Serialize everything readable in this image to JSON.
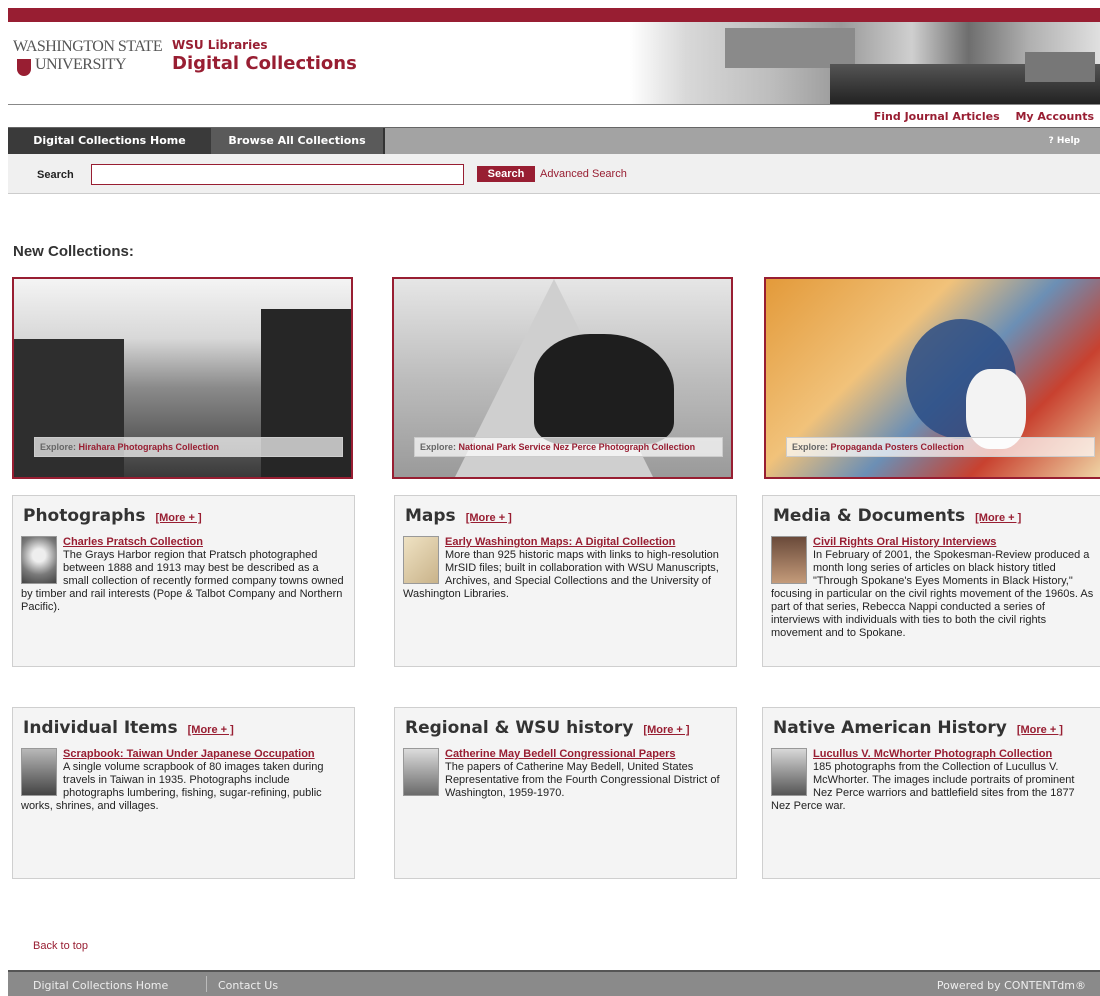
{
  "header": {
    "logo_line1": "WASHINGTON STATE",
    "logo_line2": "UNIVERSITY",
    "site_line1": "WSU Libraries",
    "site_line2": "Digital Collections"
  },
  "toplinks": [
    "Find Journal Articles",
    "My Accounts"
  ],
  "nav": {
    "tabs": [
      "Digital Collections Home",
      "Browse All Collections"
    ],
    "help": "? Help"
  },
  "search": {
    "label": "Search",
    "value": "",
    "placeholder": "",
    "button": "Search",
    "advanced": "Advanced Search"
  },
  "new_collections_title": "New Collections:",
  "featured": [
    {
      "explore": "Explore:",
      "name": "Hirahara Photographs Collection"
    },
    {
      "explore": "Explore:",
      "name": "National Park Service Nez Perce Photograph Collection"
    },
    {
      "explore": "Explore:",
      "name": "Propaganda Posters Collection"
    }
  ],
  "cards": [
    {
      "heading": "Photographs",
      "more": "[More + ]",
      "title": "Charles Pratsch Collection",
      "text": "The Grays Harbor region that Pratsch photographed between 1888 and 1913 may best be described as a small collection of recently formed company towns owned by timber and rail interests (Pope & Talbot Company and Northern Pacific)."
    },
    {
      "heading": "Maps",
      "more": "[More + ]",
      "title": "Early Washington Maps: A Digital Collection",
      "text": "More than 925 historic maps with links to high-resolution MrSID files; built in collaboration with WSU Manuscripts, Archives, and Special Collections and the University of Washington Libraries."
    },
    {
      "heading": "Media & Documents",
      "more": "[More + ]",
      "title": "Civil Rights Oral History Interviews",
      "text": "In February of 2001, the Spokesman-Review produced a month long series of articles on black history titled \"Through Spokane's Eyes Moments in Black History,\" focusing in particular on the civil rights movement of the 1960s. As part of that series, Rebecca Nappi conducted a series of interviews with individuals with ties to both the civil rights movement and to Spokane."
    },
    {
      "heading": "Individual Items",
      "more": "[More + ]",
      "title": "Scrapbook: Taiwan Under Japanese Occupation",
      "text": "A single volume scrapbook of 80 images taken during travels in Taiwan in 1935. Photographs include photographs lumbering, fishing, sugar-refining, public works, shrines, and villages."
    },
    {
      "heading": "Regional & WSU history",
      "more": "[More + ]",
      "title": "Catherine May Bedell Congressional Papers",
      "text": "The papers of Catherine May Bedell, United States Representative from the Fourth Congressional District of Washington, 1959-1970."
    },
    {
      "heading": "Native American History",
      "more": "[More + ]",
      "title": "Lucullus V. McWhorter Photograph Collection",
      "text": "185 photographs from the Collection of Lucullus V. McWhorter. The images include portraits of prominent Nez Perce warriors and battlefield sites from the 1877 Nez Perce war."
    }
  ],
  "back_to_top": "Back to top",
  "footer": {
    "home": "Digital Collections Home",
    "contact": "Contact Us",
    "powered": "Powered by CONTENTdm®"
  },
  "colors": {
    "accent": "#981e32",
    "nav_dark": "#3a3a3a",
    "nav_gray": "#a3a3a3",
    "card_bg": "#f4f4f4"
  }
}
